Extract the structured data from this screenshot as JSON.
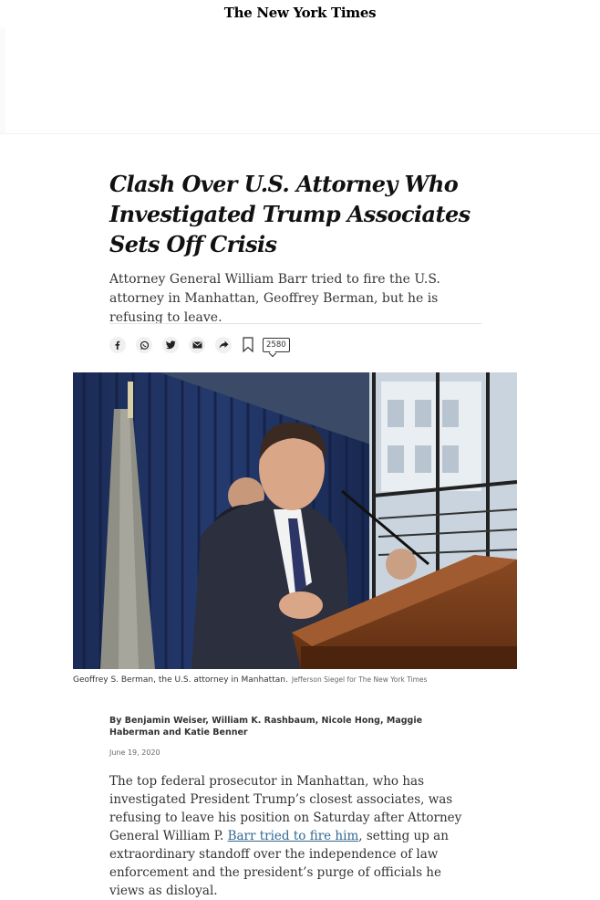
{
  "masthead": {
    "title": "The New York Times"
  },
  "article": {
    "headline": "Clash Over U.S. Attorney Who Investigated Trump Associates Sets Off Crisis",
    "summary": "Attorney General William Barr tried to fire the U.S. attorney in Manhattan, Geoffrey Berman, but he is refusing to leave.",
    "share": {
      "buttons": [
        {
          "icon": "facebook-icon"
        },
        {
          "icon": "whatsapp-icon"
        },
        {
          "icon": "twitter-icon"
        },
        {
          "icon": "email-icon"
        },
        {
          "icon": "share-icon"
        }
      ],
      "bookmark_icon": "bookmark-icon",
      "comments_count": "2580"
    },
    "photo": {
      "caption": "Geoffrey S. Berman, the U.S. attorney in Manhattan.",
      "credit": "Jefferson Siegel for The New York Times"
    },
    "byline": "By Benjamin Weiser, William K. Rashbaum, Nicole Hong, Maggie Haberman and Katie Benner",
    "date": "June 19, 2020",
    "body": {
      "before_link": "The top federal prosecutor in Manhattan, who has investigated President Trump’s closest associates, was refusing to leave his position on Saturday after Attorney General William P. ",
      "link_text": "Barr tried to fire him",
      "after_link": ", setting up an extraordinary standoff over the independence of law enforcement and the president’s purge of officials he views as disloyal."
    }
  },
  "colors": {
    "link": "#326891",
    "text": "#333333",
    "headline": "#111111"
  }
}
